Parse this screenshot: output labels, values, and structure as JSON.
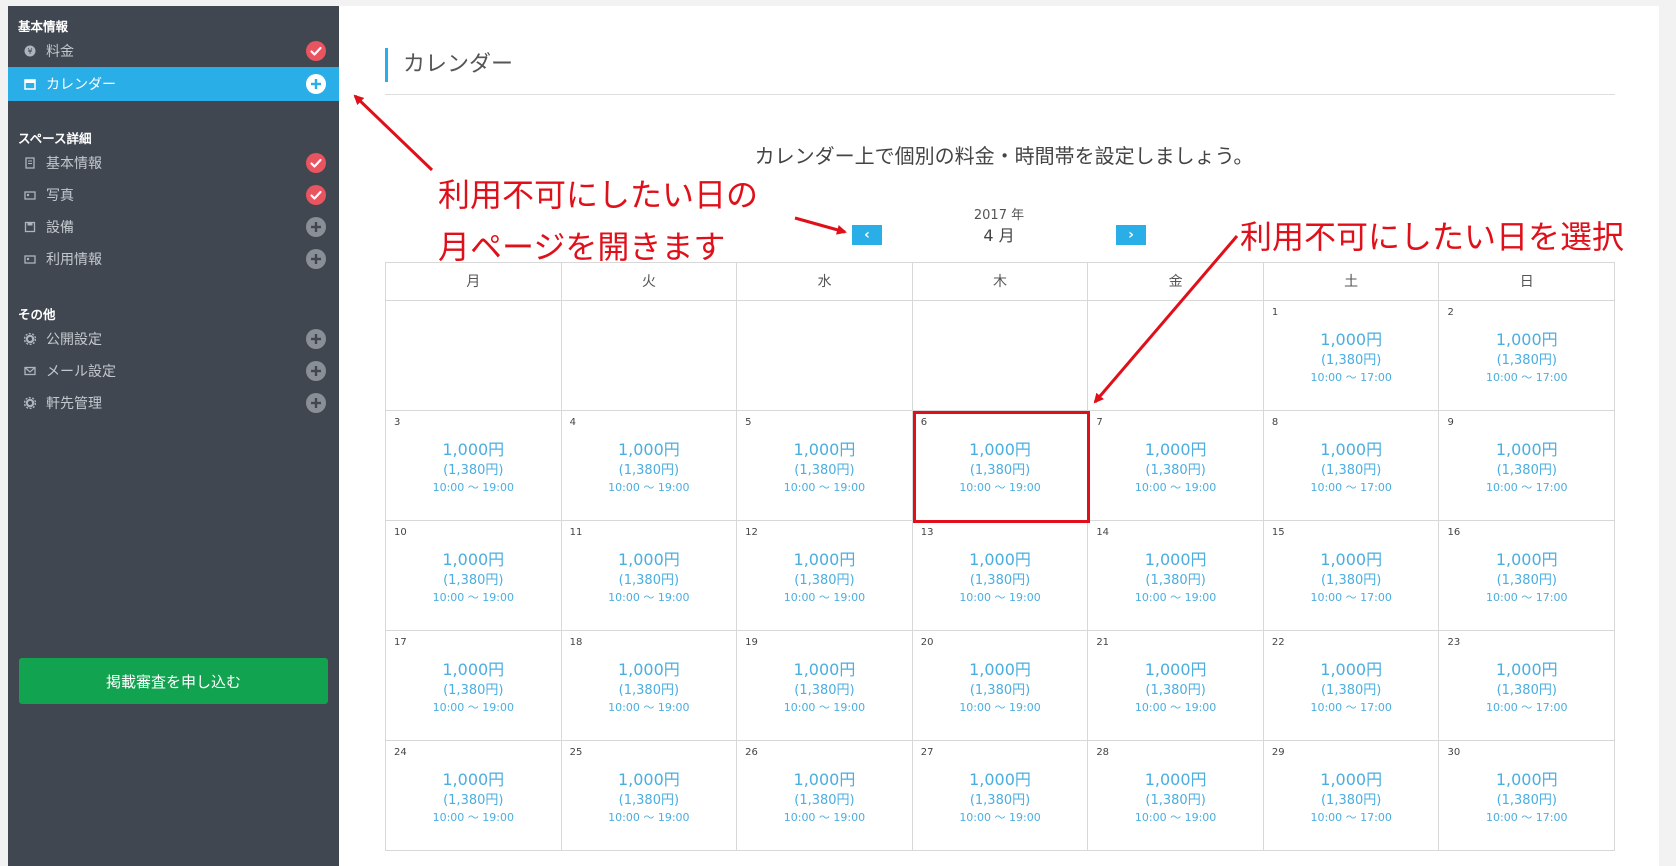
{
  "sidebar": {
    "section_basic": "基本情報",
    "section_space": "スペース詳細",
    "section_other": "その他",
    "items": [
      {
        "label": "料金",
        "icon": "yen-coin-icon",
        "status": "done"
      },
      {
        "label": "カレンダー",
        "icon": "calendar-icon",
        "status": "todo",
        "active": true
      },
      {
        "label": "基本情報",
        "icon": "document-icon",
        "status": "done"
      },
      {
        "label": "写真",
        "icon": "image-icon",
        "status": "done"
      },
      {
        "label": "設備",
        "icon": "save-icon",
        "status": "todo"
      },
      {
        "label": "利用情報",
        "icon": "image-icon",
        "status": "todo"
      },
      {
        "label": "公開設定",
        "icon": "gear-icon",
        "status": "todo"
      },
      {
        "label": "メール設定",
        "icon": "mail-icon",
        "status": "todo"
      },
      {
        "label": "軒先管理",
        "icon": "gear-icon",
        "status": "todo"
      }
    ],
    "submit_label": "掲載審査を申し込む"
  },
  "main": {
    "title": "カレンダー",
    "subtitle": "カレンダー上で個別の料金・時間帯を設定しましょう。",
    "year": "2017 年",
    "month": "4 月",
    "prev_label": "‹",
    "next_label": "›"
  },
  "calendar": {
    "weekdays": [
      "月",
      "火",
      "水",
      "木",
      "金",
      "土",
      "日"
    ],
    "price": "1,000円",
    "price_with_tax": "(1,380円)",
    "hours_weekday": "10:00 ～ 19:00",
    "hours_weekend": "10:00 ～ 17:00",
    "leading_blanks": 5,
    "days": [
      1,
      2,
      3,
      4,
      5,
      6,
      7,
      8,
      9,
      10,
      11,
      12,
      13,
      14,
      15,
      16,
      17,
      18,
      19,
      20,
      21,
      22,
      23,
      24,
      25,
      26,
      27,
      28,
      29,
      30
    ],
    "selected_day": 6
  },
  "annotations": {
    "left_line1": "利用不可にしたい日の",
    "left_line2": "月ページを開きます",
    "right": "利用不可にしたい日を選択"
  },
  "colors": {
    "accent": "#2aaee8",
    "sidebar_bg": "#414750",
    "annotation": "#e0101a",
    "submit": "#12a350",
    "done": "#e8545f"
  }
}
